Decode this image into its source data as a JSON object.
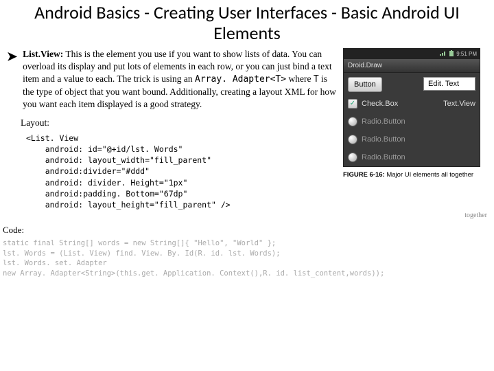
{
  "title": "Android Basics - Creating User Interfaces - \nBasic Android UI Elements",
  "bullet": {
    "name": "List.View:",
    "desc_part1": " This is the element you use if you want to show lists of data. You can overload its display and put lots of elements in each row, or you can just bind a text item and a value to each. The trick is using an ",
    "code1": "Array. Adapter<T>",
    "desc_part2": " where ",
    "code2": "T",
    "desc_part3": " is the type of object that you want bound. Additionally, creating a layout XML for how you want each item displayed is a good strategy."
  },
  "layout_label": "Layout:",
  "xml": "<List. View\n    android: id=\"@+id/lst. Words\"\n    android: layout_width=\"fill_parent\"\n    android:divider=\"#ddd\"\n    android: divider. Height=\"1px\"\n    android:padding. Bottom=\"67dp\"\n    android: layout_height=\"fill_parent\" />",
  "fragment": "together",
  "code_label": "Code:",
  "code": "static final String[] words = new String[]{ \"Hello\", \"World\" };\nlst. Words = (List. View) find. View. By. Id(R. id. lst. Words);\nlst. Words. set. Adapter\nnew Array. Adapter<String>(this.get. Application. Context(),R. id. list_content,words));",
  "phone": {
    "time": "9:51 PM",
    "appbar": "Droid.Draw",
    "button": "Button",
    "edittext": "Edit. Text",
    "checkbox": "Check.Box",
    "textview": "Text.View",
    "radio1": "Radio.Button",
    "radio2": "Radio.Button",
    "radio3": "Radio.Button"
  },
  "figure": {
    "label": "FIGURE 6-16:",
    "text": " Major UI elements all together"
  }
}
